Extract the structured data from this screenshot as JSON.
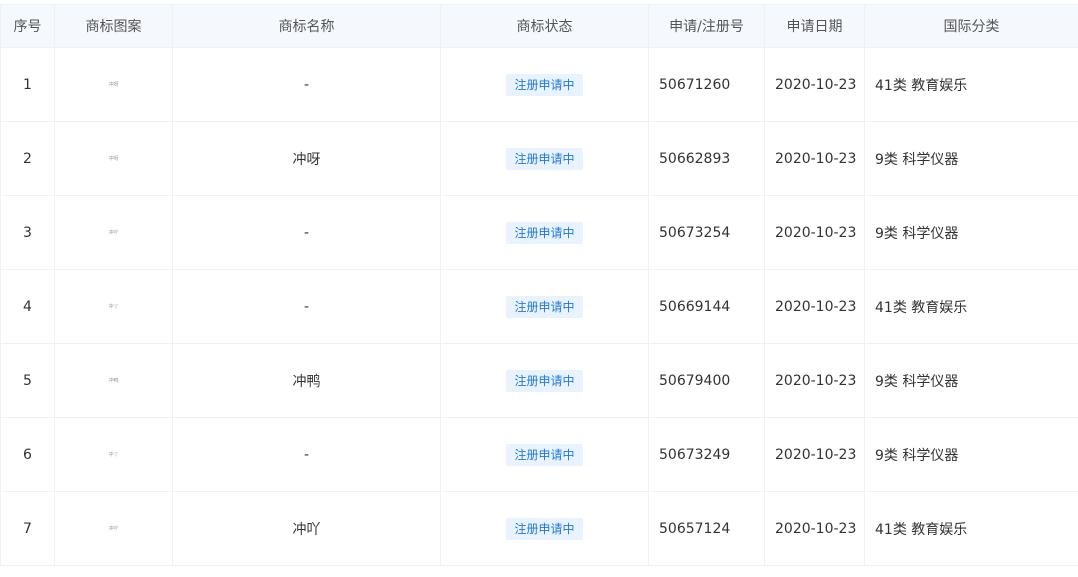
{
  "table": {
    "headers": {
      "index": "序号",
      "logo": "商标图案",
      "name": "商标名称",
      "status": "商标状态",
      "reg_no": "申请/注册号",
      "date": "申请日期",
      "class": "国际分类"
    },
    "rows": [
      {
        "index": "1",
        "logo": "冲呀",
        "name": "-",
        "status": "注册申请中",
        "reg_no": "50671260",
        "date": "2020-10-23",
        "class": "41类 教育娱乐"
      },
      {
        "index": "2",
        "logo": "冲呀",
        "name": "冲呀",
        "status": "注册申请中",
        "reg_no": "50662893",
        "date": "2020-10-23",
        "class": "9类 科学仪器"
      },
      {
        "index": "3",
        "logo": "冲吖",
        "name": "-",
        "status": "注册申请中",
        "reg_no": "50673254",
        "date": "2020-10-23",
        "class": "9类 科学仪器"
      },
      {
        "index": "4",
        "logo": "冲丫",
        "name": "-",
        "status": "注册申请中",
        "reg_no": "50669144",
        "date": "2020-10-23",
        "class": "41类 教育娱乐"
      },
      {
        "index": "5",
        "logo": "冲鸭",
        "name": "冲鸭",
        "status": "注册申请中",
        "reg_no": "50679400",
        "date": "2020-10-23",
        "class": "9类 科学仪器"
      },
      {
        "index": "6",
        "logo": "冲丫",
        "name": "-",
        "status": "注册申请中",
        "reg_no": "50673249",
        "date": "2020-10-23",
        "class": "9类 科学仪器"
      },
      {
        "index": "7",
        "logo": "冲吖",
        "name": "冲吖",
        "status": "注册申请中",
        "reg_no": "50657124",
        "date": "2020-10-23",
        "class": "41类 教育娱乐"
      }
    ]
  },
  "colors": {
    "header_bg": "#f5f8fc",
    "status_bg": "#e8f3ff",
    "status_text": "#1f7ad6",
    "grid": "#eef1f5"
  }
}
